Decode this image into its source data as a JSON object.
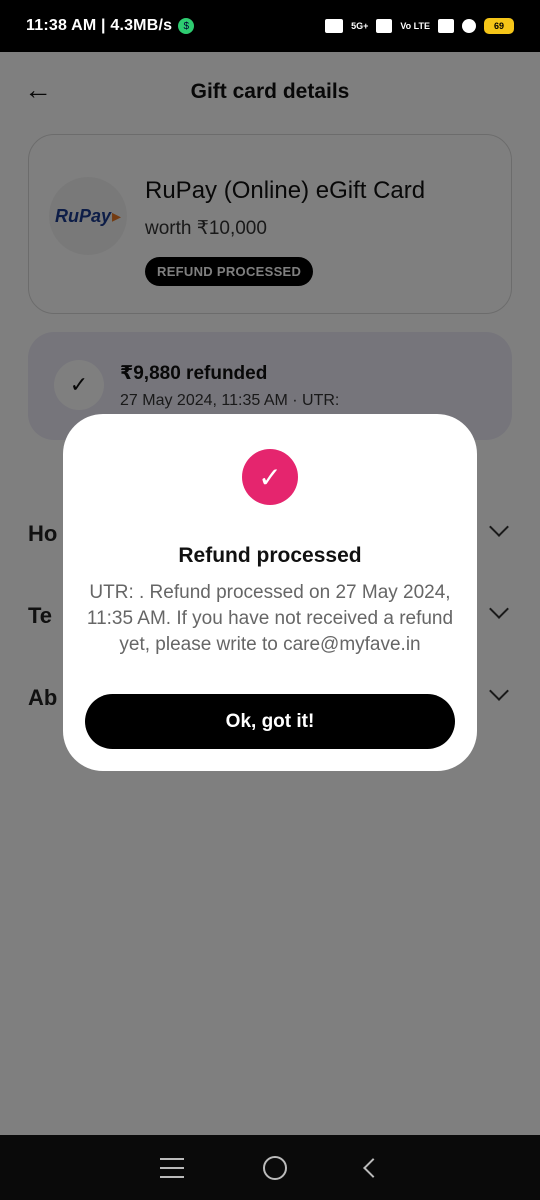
{
  "status_bar": {
    "time_speed": "11:38 AM | 4.3MB/s",
    "battery": "69",
    "network_1": "5G+",
    "network_2": "Vo LTE"
  },
  "header": {
    "title": "Gift card details"
  },
  "card": {
    "logo_text": "RuPay",
    "name": "RuPay (Online) eGift Card",
    "worth": "worth ₹10,000",
    "badge": "REFUND PROCESSED"
  },
  "refund": {
    "amount": "₹9,880 refunded",
    "meta": "27 May 2024, 11:35 AM · UTR:"
  },
  "accordions": [
    {
      "label": "Ho"
    },
    {
      "label": "Te"
    },
    {
      "label": "Ab"
    }
  ],
  "modal": {
    "title": "Refund processed",
    "body": "UTR: . Refund processed on 27 May 2024, 11:35 AM. If you have not received a refund yet, please write to care@myfave.in",
    "button": "Ok, got it!"
  },
  "colors": {
    "accent_pink": "#e5256e",
    "refund_box": "#eceaf7",
    "battery": "#f5c518"
  }
}
